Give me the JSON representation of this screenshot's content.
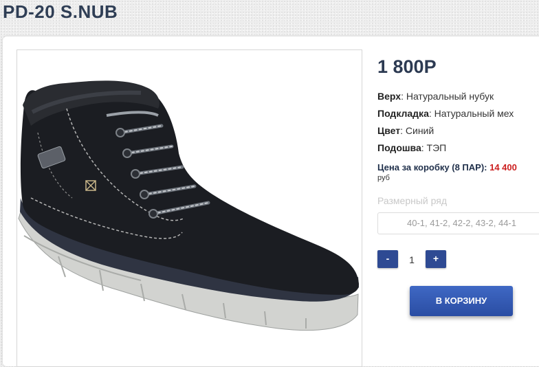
{
  "product": {
    "title": "PD-20 S.NUB",
    "price": "1 800Р",
    "specs": [
      {
        "label": "Верх",
        "value": "Натуральный нубук"
      },
      {
        "label": "Подкладка",
        "value": "Натуральный мех"
      },
      {
        "label": "Цвет",
        "value": "Синий"
      },
      {
        "label": "Подошва",
        "value": "ТЭП"
      }
    ],
    "box_price": {
      "label": "Цена за коробку (8 ПАР):",
      "value": "14 400",
      "currency": "руб"
    },
    "sizes": {
      "label": "Размерный ряд",
      "value": "40-1, 41-2, 42-2, 43-2, 44-1"
    },
    "quantity": {
      "minus": "-",
      "value": "1",
      "plus": "+"
    },
    "cart_button": "В КОРЗИНУ"
  },
  "colors": {
    "accent": "#2e4a93",
    "price_red": "#cc1f1f",
    "title": "#2f3e55"
  }
}
